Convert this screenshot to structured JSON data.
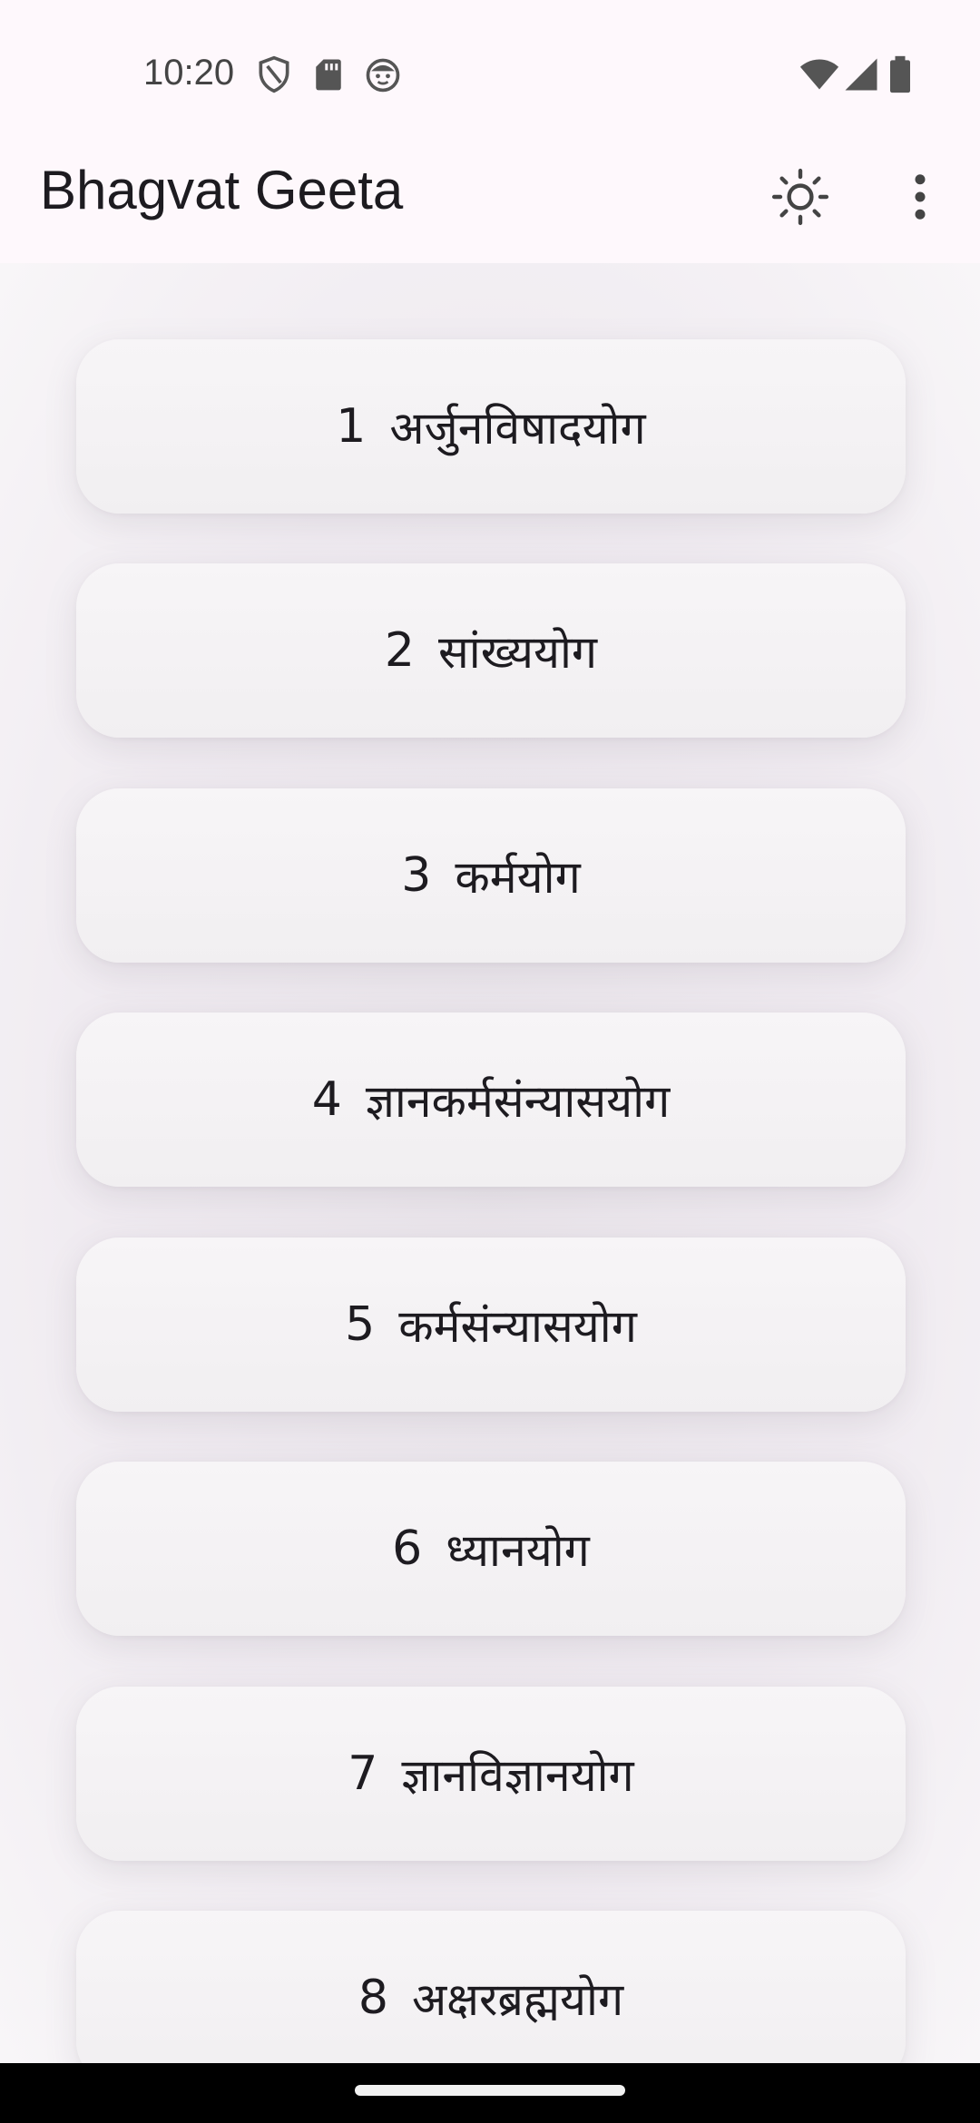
{
  "status_bar": {
    "time": "10:20",
    "icons_left": [
      "shield-icon",
      "sd-card-icon",
      "face-icon"
    ],
    "icons_right": [
      "wifi-icon",
      "signal-icon",
      "battery-icon"
    ]
  },
  "app_bar": {
    "title": "Bhagvat Geeta",
    "theme_icon": "brightness-icon",
    "menu_icon": "more-vert-icon"
  },
  "chapters": [
    {
      "number": "1",
      "name": "अर्जुनविषादयोग"
    },
    {
      "number": "2",
      "name": "सांख्ययोग"
    },
    {
      "number": "3",
      "name": "कर्मयोग"
    },
    {
      "number": "4",
      "name": "ज्ञानकर्मसंन्यासयोग"
    },
    {
      "number": "5",
      "name": "कर्मसंन्यासयोग"
    },
    {
      "number": "6",
      "name": "ध्यानयोग"
    },
    {
      "number": "7",
      "name": "ज्ञानविज्ञानयोग"
    },
    {
      "number": "8",
      "name": "अक्षरब्रह्मयोग"
    }
  ],
  "colors": {
    "app_bar_bg": "#fef8fc",
    "card_bg": "#f4f2f4",
    "text": "#1d1b20",
    "nav_bar": "#000000"
  }
}
